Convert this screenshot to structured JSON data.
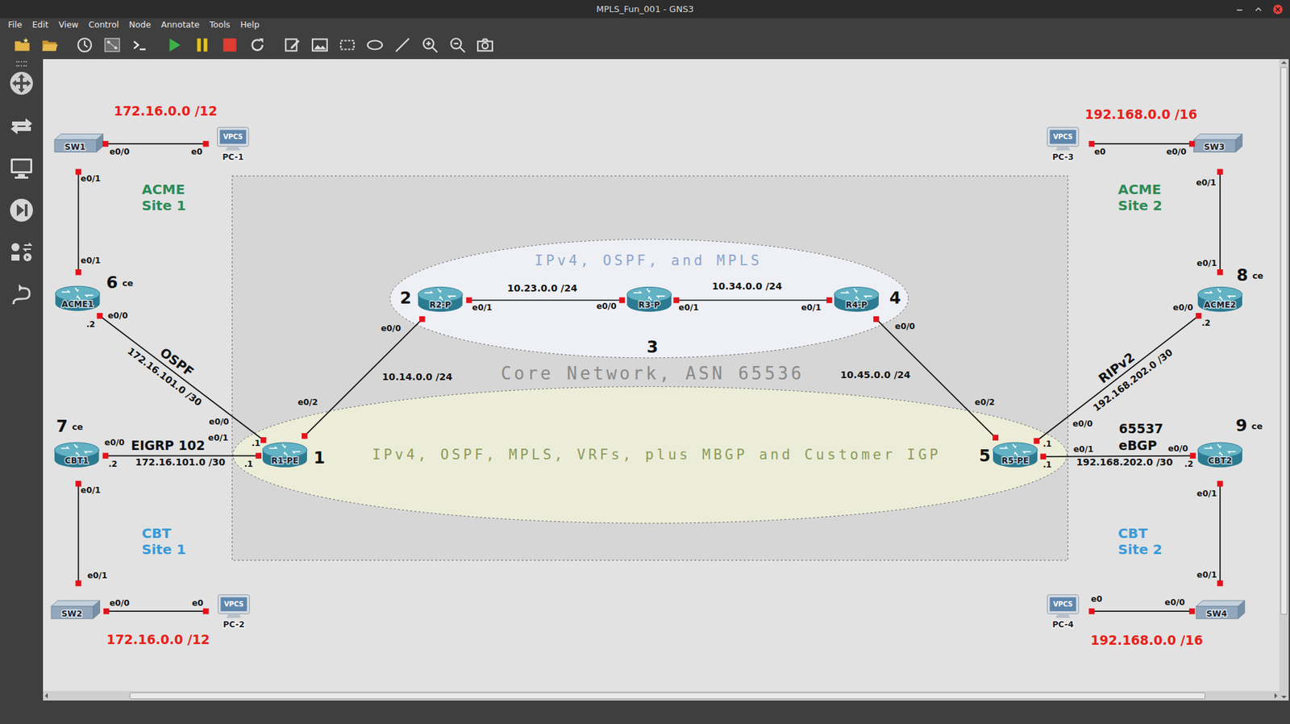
{
  "window": {
    "title": "MPLS_Fun_001 - GNS3"
  },
  "menu": [
    "File",
    "Edit",
    "View",
    "Control",
    "Node",
    "Annotate",
    "Tools",
    "Help"
  ],
  "diagram": {
    "nodes": [
      {
        "label": "SW1",
        "kind": "switch"
      },
      {
        "label": "PC-1",
        "kind": "vpcs",
        "icon_text": "VPCS"
      },
      {
        "label": "ACME1",
        "kind": "router",
        "number": "6",
        "role": "ce"
      },
      {
        "label": "CBT1",
        "kind": "router",
        "number": "7",
        "role": "ce"
      },
      {
        "label": "SW2",
        "kind": "switch"
      },
      {
        "label": "PC-2",
        "kind": "vpcs",
        "icon_text": "VPCS"
      },
      {
        "label": "R1-PE",
        "kind": "router",
        "number": "1"
      },
      {
        "label": "R2-P",
        "kind": "router",
        "number": "2"
      },
      {
        "label": "R3-P",
        "kind": "router",
        "number": "3"
      },
      {
        "label": "R4-P",
        "kind": "router",
        "number": "4"
      },
      {
        "label": "R5-PE",
        "kind": "router",
        "number": "5"
      },
      {
        "label": "ACME2",
        "kind": "router",
        "number": "8",
        "role": "ce"
      },
      {
        "label": "CBT2",
        "kind": "router",
        "number": "9",
        "role": "ce"
      },
      {
        "label": "PC-3",
        "kind": "vpcs",
        "icon_text": "VPCS"
      },
      {
        "label": "SW3",
        "kind": "switch"
      },
      {
        "label": "PC-4",
        "kind": "vpcs",
        "icon_text": "VPCS"
      },
      {
        "label": "SW4",
        "kind": "switch"
      }
    ],
    "links": [
      {
        "a_port": "e0/0",
        "b_port": "e0"
      },
      {
        "a_port": "e0/1",
        "b_port": "e0/1"
      },
      {
        "a_port": "e0/0",
        "a_ip": ".2",
        "b_port": "e0/0",
        "b_ip": ".1",
        "subnet": "172.16.101.0 /30",
        "protocol": "OSPF"
      },
      {
        "a_port": "e0/0",
        "a_ip": ".2",
        "b_port": "e0/1",
        "b_ip": ".1",
        "subnet": "172.16.101.0 /30",
        "protocol": "EIGRP 102"
      },
      {
        "a_port": "e0/1",
        "b_port": "e0/1"
      },
      {
        "a_port": "e0/0",
        "b_port": "e0"
      },
      {
        "a_port": "e0/2",
        "b_port": "e0/0",
        "subnet": "10.14.0.0 /24"
      },
      {
        "a_port": "e0/1",
        "b_port": "e0/0",
        "subnet": "10.23.0.0 /24"
      },
      {
        "a_port": "e0/1",
        "b_port": "e0/1",
        "subnet": "10.34.0.0 /24"
      },
      {
        "a_port": "e0/0",
        "b_port": "e0/2",
        "subnet": "10.45.0.0 /24"
      },
      {
        "a_port": "e0/0",
        "a_ip": ".1",
        "b_port": "e0/0",
        "b_ip": ".2",
        "subnet": "192.168.202.0 /30",
        "protocol": "RIPv2"
      },
      {
        "a_port": "e0/1",
        "a_ip": ".1",
        "b_port": "e0/0",
        "b_ip": ".2",
        "subnet": "192.168.202.0 /30",
        "protocol": "eBGP",
        "asn": "65537"
      },
      {
        "a_port": "e0/1",
        "b_port": "e0/1"
      },
      {
        "a_port": "e0/0",
        "b_port": "e0"
      },
      {
        "a_port": "e0/0",
        "b_port": "e0"
      },
      {
        "a_port": "e0/1",
        "b_port": "e0/1"
      }
    ],
    "annotations": [
      {
        "kind": "subnet",
        "lines": [
          "172.16.0.0 /12"
        ],
        "color": "#e8201a"
      },
      {
        "kind": "subnet",
        "lines": [
          "192.168.0.0 /16"
        ],
        "color": "#e8201a"
      },
      {
        "kind": "subnet",
        "lines": [
          "172.16.0.0 /12"
        ],
        "color": "#e8201a"
      },
      {
        "kind": "subnet",
        "lines": [
          "192.168.0.0 /16"
        ],
        "color": "#e8201a"
      },
      {
        "kind": "site",
        "lines": [
          "ACME",
          "Site 1"
        ],
        "color": "#2e8b57"
      },
      {
        "kind": "site",
        "lines": [
          "ACME",
          "Site 2"
        ],
        "color": "#2e8b57"
      },
      {
        "kind": "site",
        "lines": [
          "CBT",
          "Site 1"
        ],
        "color": "#3a9ad9"
      },
      {
        "kind": "site",
        "lines": [
          "CBT",
          "Site 2"
        ],
        "color": "#3a9ad9"
      },
      {
        "kind": "zone",
        "lines": [
          "IPv4, OSPF, and MPLS"
        ],
        "color": "#8ca5cc"
      },
      {
        "kind": "title",
        "lines": [
          "Core Network, ASN 65536"
        ],
        "color": "#8a8a8a"
      },
      {
        "kind": "zone",
        "lines": [
          "IPv4, OSPF, MPLS, VRFs, plus MBGP and Customer IGP"
        ],
        "color": "#8c9c5c"
      }
    ]
  }
}
